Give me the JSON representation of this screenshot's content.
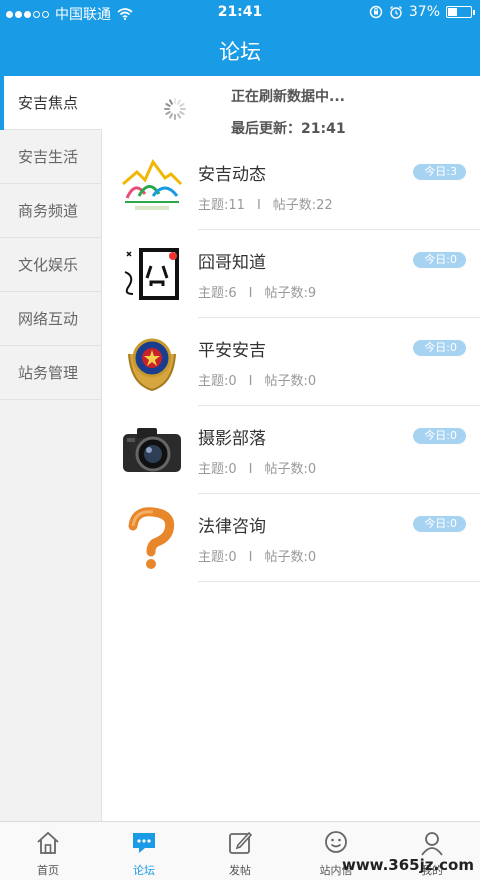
{
  "status_bar": {
    "carrier": "中国联通",
    "time": "21:41",
    "battery_percent": "37%",
    "battery_level": 0.37
  },
  "nav": {
    "title": "论坛"
  },
  "sidebar": {
    "items": [
      {
        "label": "安吉焦点",
        "active": true
      },
      {
        "label": "安吉生活",
        "active": false
      },
      {
        "label": "商务频道",
        "active": false
      },
      {
        "label": "文化娱乐",
        "active": false
      },
      {
        "label": "网络互动",
        "active": false
      },
      {
        "label": "站务管理",
        "active": false
      }
    ]
  },
  "refresh": {
    "status": "正在刷新数据中...",
    "last_update": "最后更新：21:41"
  },
  "forums": [
    {
      "name": "安吉动态",
      "topics": "主题:11",
      "posts": "帖子数:22",
      "today": "今日:3",
      "icon": "anji-logo-icon"
    },
    {
      "name": "囧哥知道",
      "topics": "主题:6",
      "posts": "帖子数:9",
      "today": "今日:0",
      "icon": "jiong-character-icon"
    },
    {
      "name": "平安安吉",
      "topics": "主题:0",
      "posts": "帖子数:0",
      "today": "今日:0",
      "icon": "police-badge-icon"
    },
    {
      "name": "摄影部落",
      "topics": "主题:0",
      "posts": "帖子数:0",
      "today": "今日:0",
      "icon": "camera-icon"
    },
    {
      "name": "法律咨询",
      "topics": "主题:0",
      "posts": "帖子数:0",
      "today": "今日:0",
      "icon": "question-mark-icon"
    }
  ],
  "separator": "I",
  "tabbar": {
    "items": [
      {
        "label": "首页",
        "icon": "home-icon",
        "active": false
      },
      {
        "label": "论坛",
        "icon": "chat-bubble-icon",
        "active": true
      },
      {
        "label": "发帖",
        "icon": "compose-icon",
        "active": false
      },
      {
        "label": "站内信",
        "icon": "smiley-message-icon",
        "active": false
      },
      {
        "label": "我的",
        "icon": "user-icon",
        "active": false
      }
    ]
  },
  "watermark": "www.365jz.com",
  "colors": {
    "accent": "#1a9be6",
    "badge": "#a7d3f2",
    "sidebar_bg": "#f2f2f2"
  }
}
